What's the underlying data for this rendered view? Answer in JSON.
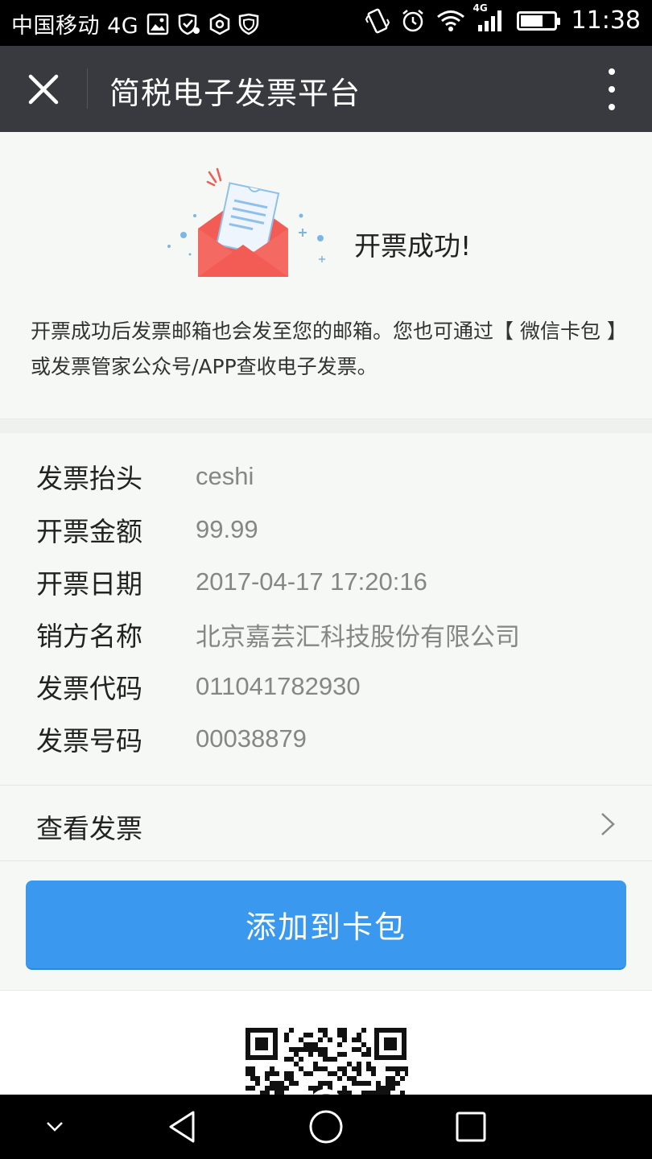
{
  "status_bar": {
    "carrier": "中国移动 4G",
    "network_badge": "4G",
    "time": "11:38"
  },
  "title_bar": {
    "title": "简税电子发票平台"
  },
  "success": {
    "message": "开票成功!",
    "description": "开票成功后发票邮箱也会发至您的邮箱。您也可通过【 微信卡包 】或发票管家公众号/APP查收电子发票。"
  },
  "invoice_details": [
    {
      "label": "发票抬头",
      "value": "ceshi"
    },
    {
      "label": "开票金额",
      "value": "99.99"
    },
    {
      "label": "开票日期",
      "value": "2017-04-17 17:20:16"
    },
    {
      "label": "销方名称",
      "value": "北京嘉芸汇科技股份有限公司"
    },
    {
      "label": "发票代码",
      "value": "011041782930"
    },
    {
      "label": "发票号码",
      "value": "00038879"
    }
  ],
  "view_invoice": {
    "label": "查看发票"
  },
  "add_button": {
    "label": "添加到卡包"
  },
  "colors": {
    "accent": "#3a98ee",
    "titlebar": "#393a3f",
    "envelope": "#f25c54"
  }
}
